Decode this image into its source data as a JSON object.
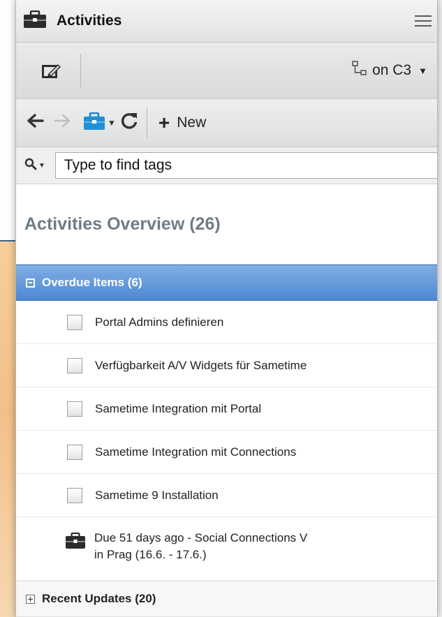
{
  "panel": {
    "title": "Activities",
    "community_label": "on C3",
    "new_label": "New",
    "search_placeholder": "Type to find tags",
    "overview_title": "Activities Overview (26)"
  },
  "sections": {
    "overdue": {
      "label": "Overdue Items (6)",
      "items": [
        "Portal Admins definieren",
        "Verfügbarkeit A/V Widgets für Sametime",
        "Sametime Integration mit Portal",
        "Sametime Integration mit Connections",
        "Sametime 9 Installation"
      ],
      "activity_line1": "Due 51 days ago - Social Connections V",
      "activity_line2": "in Prag (16.6. - 17.6.)"
    },
    "recent": {
      "label": "Recent Updates (20)"
    }
  },
  "colors": {
    "section_highlight": "#5b92d8",
    "overview_text": "#6f7c86",
    "background_accent": "#f3c088"
  },
  "icons": [
    "briefcase-icon",
    "menu-icon",
    "edit-icon",
    "community-icon",
    "back-arrow-icon",
    "forward-arrow-icon",
    "refresh-icon",
    "plus-icon",
    "search-icon",
    "checkbox-icon",
    "collapse-icon",
    "expand-icon"
  ]
}
